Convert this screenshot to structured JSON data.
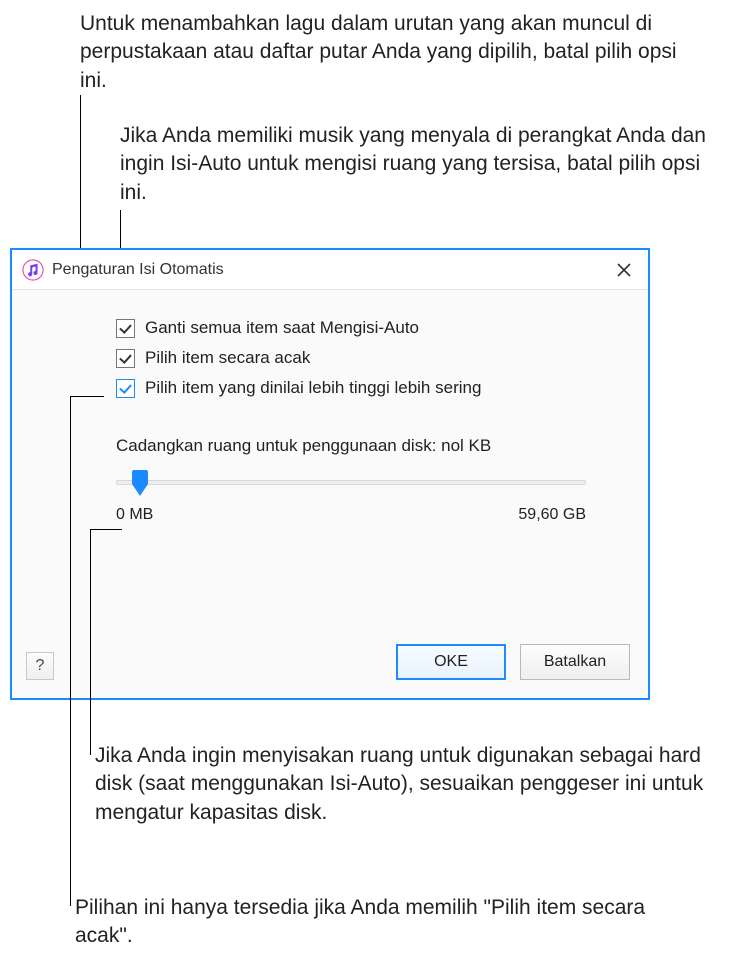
{
  "annotations": {
    "ann1": "Untuk menambahkan lagu dalam urutan yang akan muncul di perpustakaan atau daftar putar Anda yang dipilih, batal pilih opsi ini.",
    "ann2": "Jika Anda memiliki musik yang menyala di perangkat Anda dan ingin Isi-Auto untuk mengisi ruang yang tersisa, batal pilih opsi ini.",
    "ann3": "Jika Anda ingin menyisakan ruang untuk digunakan sebagai hard disk (saat menggunakan Isi-Auto), sesuaikan penggeser ini untuk mengatur kapasitas disk.",
    "ann4": "Pilihan ini hanya tersedia jika Anda memilih \"Pilih item secara acak\"."
  },
  "dialog": {
    "title": "Pengaturan Isi Otomatis",
    "checkboxes": {
      "replace_all": "Ganti semua item saat Mengisi-Auto",
      "random": "Pilih item secara acak",
      "higher_rated": "Pilih item yang dinilai lebih tinggi lebih sering"
    },
    "slider": {
      "label": "Cadangkan ruang untuk penggunaan disk: nol KB",
      "min_label": "0 MB",
      "max_label": "59,60 GB"
    },
    "buttons": {
      "ok": "OKE",
      "cancel": "Batalkan",
      "help": "?"
    }
  }
}
